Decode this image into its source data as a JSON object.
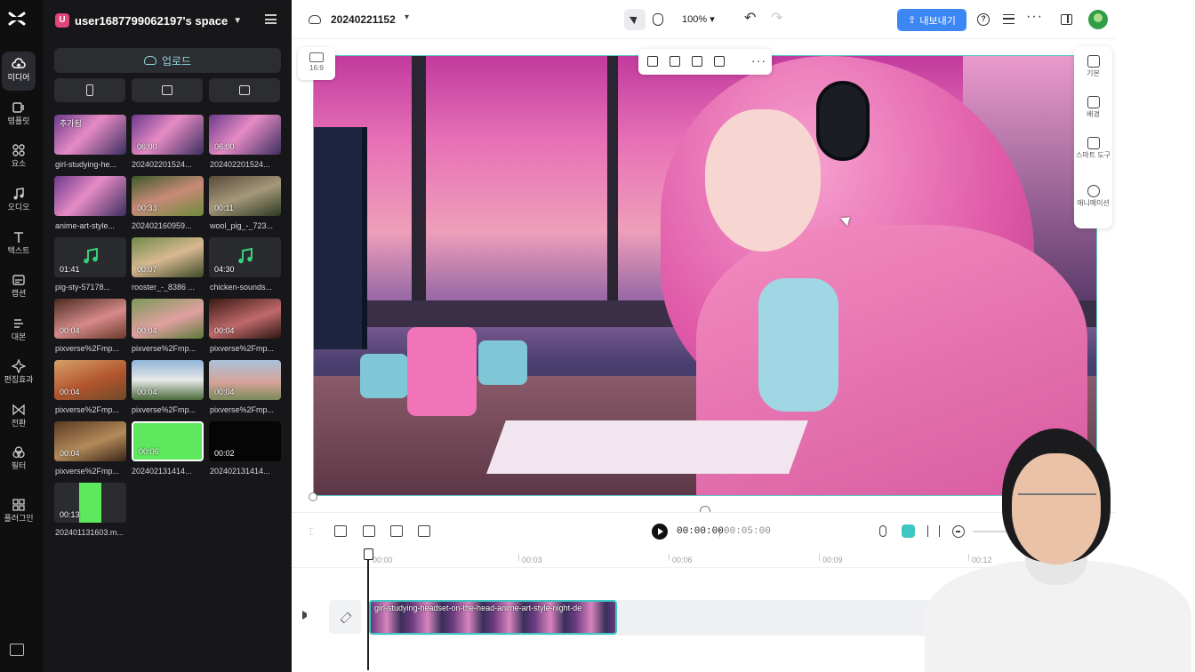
{
  "rail": {
    "items": [
      {
        "label": "미디어",
        "icon": "cloud-upload-icon"
      },
      {
        "label": "템플릿",
        "icon": "template-icon"
      },
      {
        "label": "요소",
        "icon": "elements-icon"
      },
      {
        "label": "오디오",
        "icon": "music-note-icon"
      },
      {
        "label": "텍스트",
        "icon": "text-icon"
      },
      {
        "label": "캡션",
        "icon": "caption-icon"
      },
      {
        "label": "대본",
        "icon": "script-icon"
      },
      {
        "label": "편집효과",
        "icon": "effects-icon"
      },
      {
        "label": "전환",
        "icon": "transition-icon"
      },
      {
        "label": "필터",
        "icon": "filter-icon"
      },
      {
        "label": "플러그인",
        "icon": "plugin-icon"
      }
    ]
  },
  "panel": {
    "space_initial": "U",
    "space_name": "user1687799062197's space",
    "upload_label": "업로드",
    "media": [
      {
        "name": "girl-studying-he...",
        "badge": "추가됨",
        "duration": ""
      },
      {
        "name": "202402201524...",
        "badge": "",
        "duration": "06:00"
      },
      {
        "name": "202402201524...",
        "badge": "",
        "duration": "06:00"
      },
      {
        "name": "anime-art-style...",
        "badge": "",
        "duration": ""
      },
      {
        "name": "202402160959...",
        "badge": "",
        "duration": "00:33"
      },
      {
        "name": "wool_pig_-_723...",
        "badge": "",
        "duration": "00:11"
      },
      {
        "name": "pig-sty-57178...",
        "badge": "",
        "duration": "01:41"
      },
      {
        "name": "rooster_-_8386 ...",
        "badge": "",
        "duration": "00:07"
      },
      {
        "name": "chicken-sounds...",
        "badge": "",
        "duration": "04:30"
      },
      {
        "name": "pixverse%2Fmp...",
        "badge": "",
        "duration": "00:04"
      },
      {
        "name": "pixverse%2Fmp...",
        "badge": "",
        "duration": "00:04"
      },
      {
        "name": "pixverse%2Fmp...",
        "badge": "",
        "duration": "00:04"
      },
      {
        "name": "pixverse%2Fmp...",
        "badge": "",
        "duration": "00:04"
      },
      {
        "name": "pixverse%2Fmp...",
        "badge": "",
        "duration": "00:04"
      },
      {
        "name": "pixverse%2Fmp...",
        "badge": "",
        "duration": "00:04"
      },
      {
        "name": "pixverse%2Fmp...",
        "badge": "",
        "duration": "00:04"
      },
      {
        "name": "202402131414...",
        "badge": "",
        "duration": "00:06"
      },
      {
        "name": "202402131414...",
        "badge": "",
        "duration": "00:02"
      },
      {
        "name": "202401131603.m...",
        "badge": "",
        "duration": "00:13"
      }
    ]
  },
  "topbar": {
    "project_title": "20240221152",
    "zoom": "100%",
    "export_label": "내보내기"
  },
  "canvas": {
    "ratio_label": "16:9"
  },
  "right_tools": [
    {
      "label": "기본",
      "icon": "basic-icon"
    },
    {
      "label": "배경",
      "icon": "background-icon"
    },
    {
      "label": "스마트 도구",
      "icon": "magic-wand-icon"
    },
    {
      "label": "애니메이션",
      "icon": "animation-icon"
    }
  ],
  "timeline": {
    "current_time": "00:00:00",
    "separator": "|",
    "total_time": "00:05:00",
    "ruler": [
      "00:00",
      "00:03",
      "00:06",
      "00:09",
      "00:12"
    ],
    "clip_label": "girl-studying-headset-on-the-head-anime-art-style-night-de"
  },
  "colors": {
    "accent": "#3d87f5",
    "selection": "#3ec7c2",
    "panel_bg": "#17171a"
  }
}
